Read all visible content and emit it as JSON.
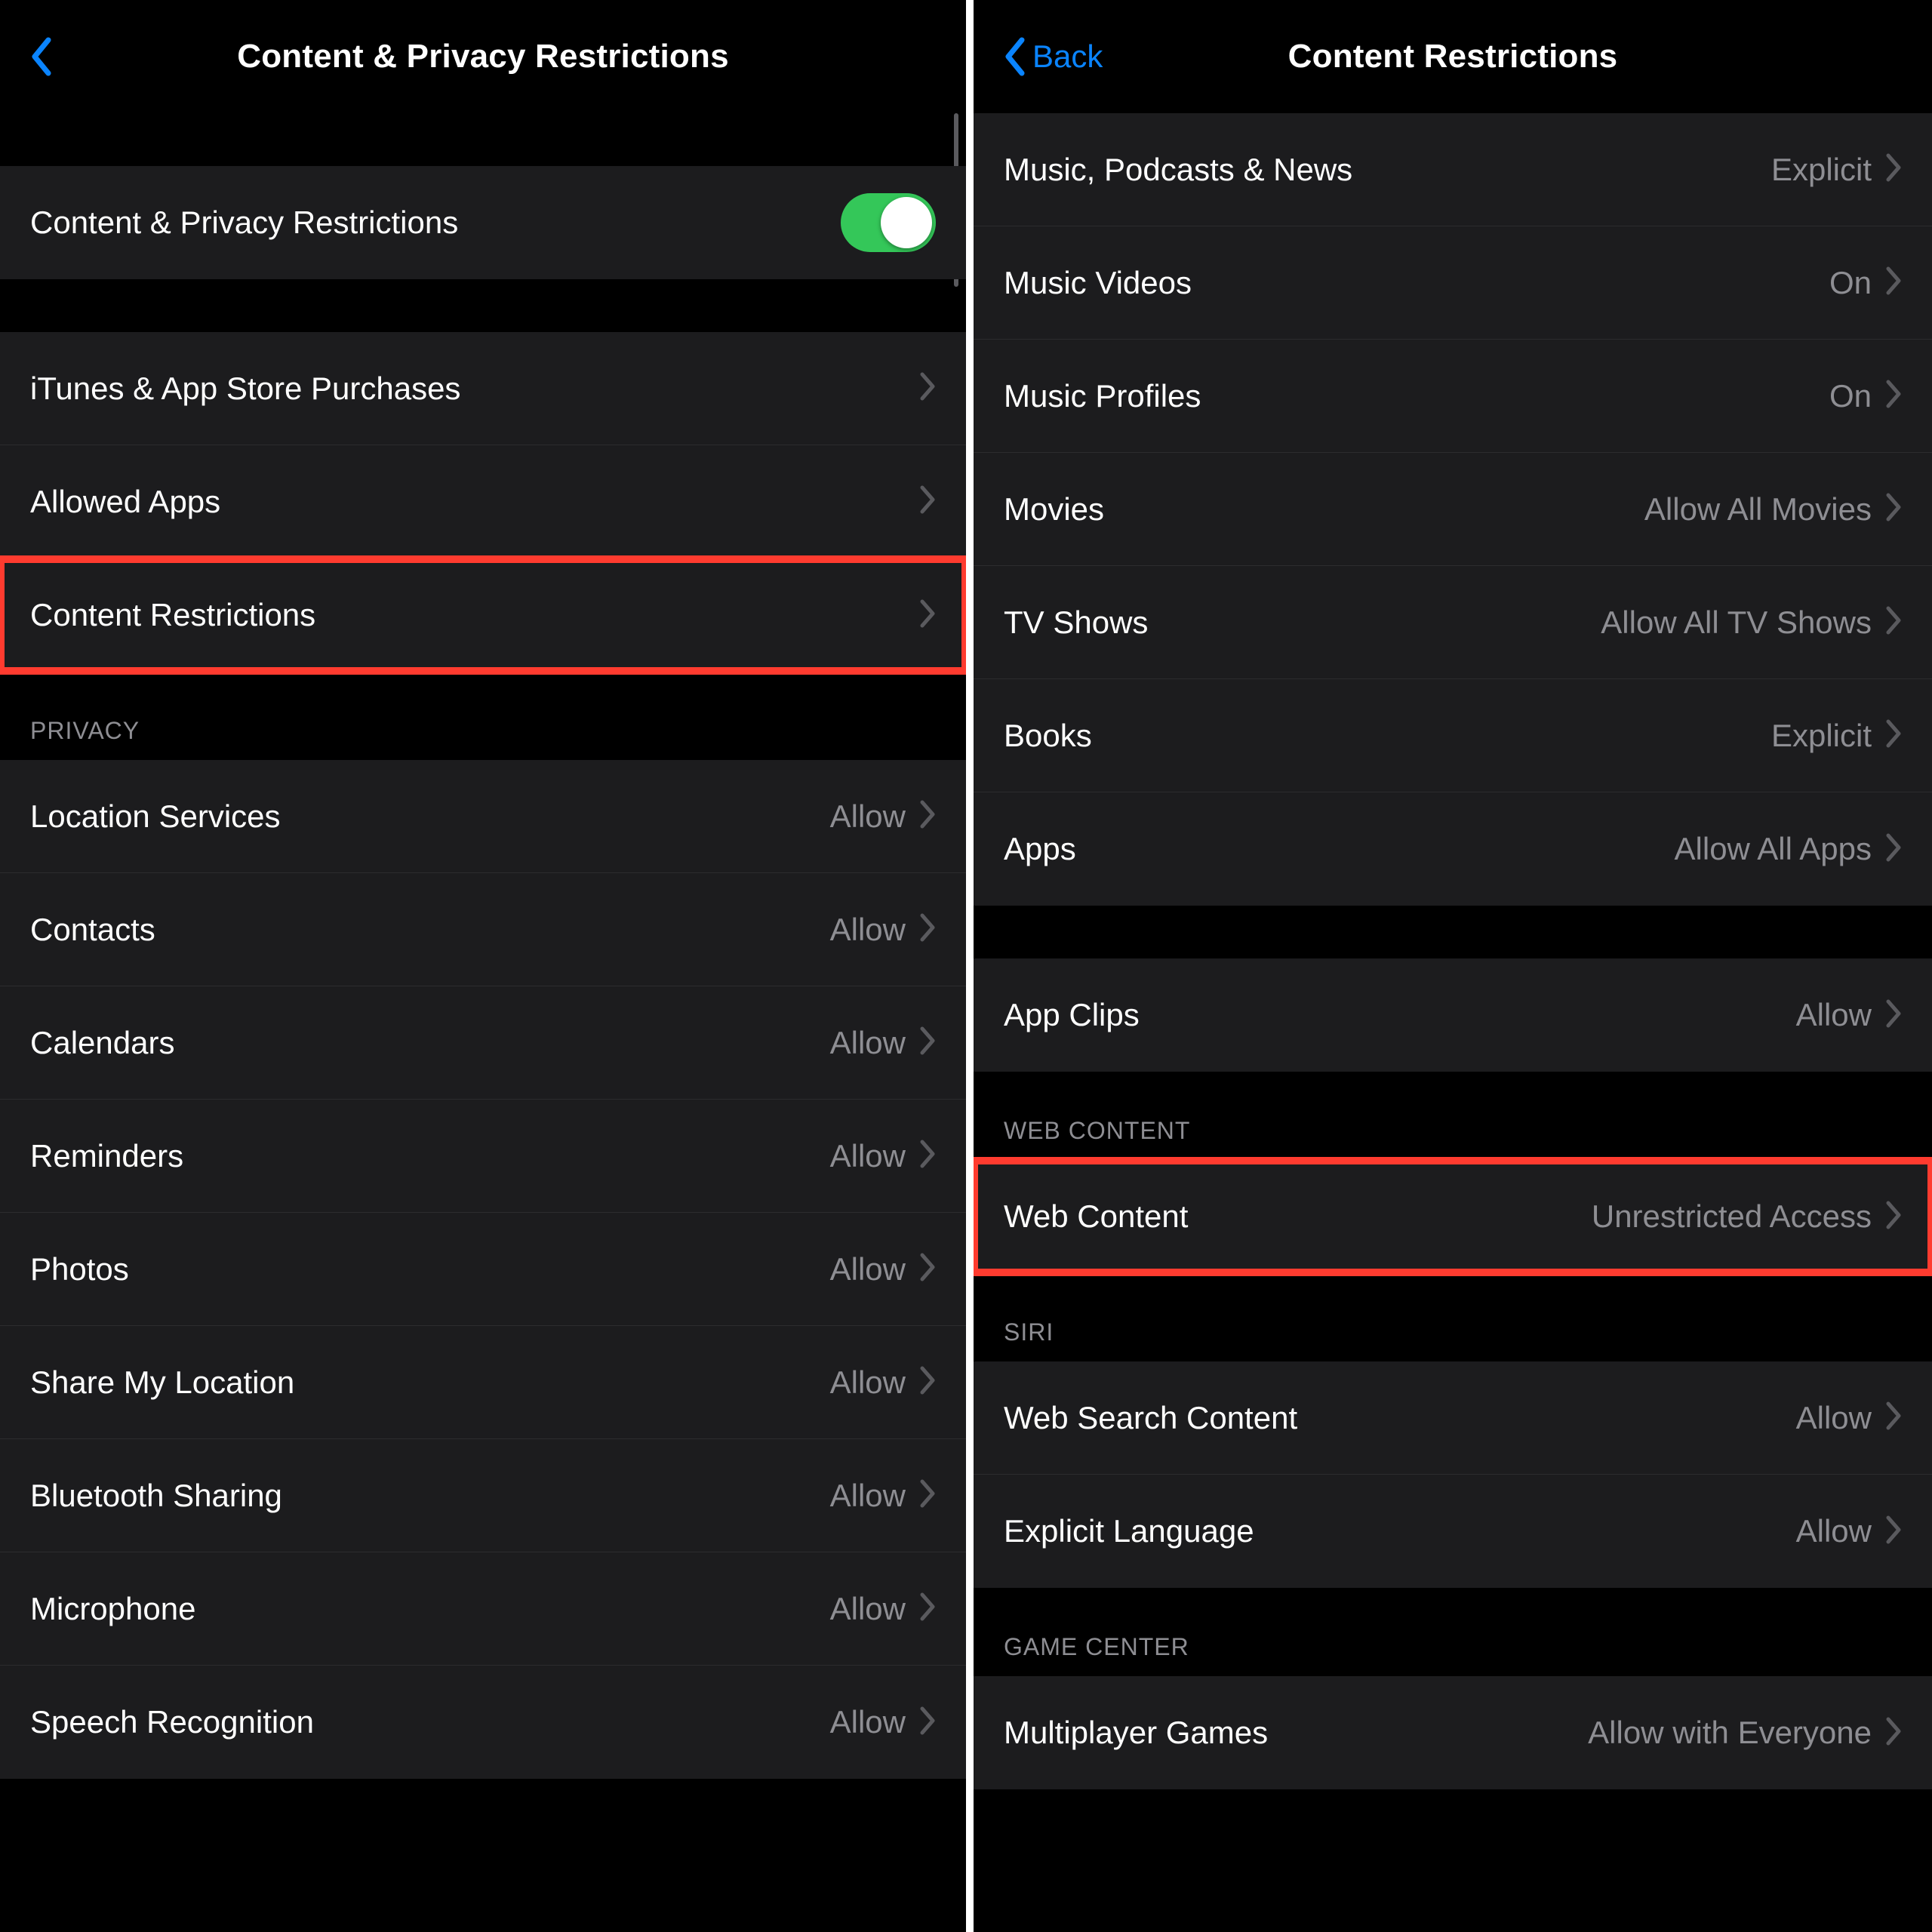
{
  "left": {
    "nav": {
      "title": "Content & Privacy Restrictions",
      "back_label": ""
    },
    "toggle_row": {
      "label": "Content & Privacy Restrictions",
      "on": true
    },
    "group1": [
      {
        "label": "iTunes & App Store Purchases",
        "value": ""
      },
      {
        "label": "Allowed Apps",
        "value": ""
      },
      {
        "label": "Content Restrictions",
        "value": "",
        "highlight": true
      }
    ],
    "privacy_header": "Privacy",
    "privacy": [
      {
        "label": "Location Services",
        "value": "Allow"
      },
      {
        "label": "Contacts",
        "value": "Allow"
      },
      {
        "label": "Calendars",
        "value": "Allow"
      },
      {
        "label": "Reminders",
        "value": "Allow"
      },
      {
        "label": "Photos",
        "value": "Allow"
      },
      {
        "label": "Share My Location",
        "value": "Allow"
      },
      {
        "label": "Bluetooth Sharing",
        "value": "Allow"
      },
      {
        "label": "Microphone",
        "value": "Allow"
      },
      {
        "label": "Speech Recognition",
        "value": "Allow"
      }
    ]
  },
  "right": {
    "nav": {
      "title": "Content Restrictions",
      "back_label": "Back"
    },
    "group1": [
      {
        "label": "Music, Podcasts & News",
        "value": "Explicit"
      },
      {
        "label": "Music Videos",
        "value": "On"
      },
      {
        "label": "Music Profiles",
        "value": "On"
      },
      {
        "label": "Movies",
        "value": "Allow All Movies"
      },
      {
        "label": "TV Shows",
        "value": "Allow All TV Shows"
      },
      {
        "label": "Books",
        "value": "Explicit"
      },
      {
        "label": "Apps",
        "value": "Allow All Apps"
      }
    ],
    "group2": [
      {
        "label": "App Clips",
        "value": "Allow"
      }
    ],
    "web_header": "Web Content",
    "web": [
      {
        "label": "Web Content",
        "value": "Unrestricted Access",
        "highlight": true
      }
    ],
    "siri_header": "Siri",
    "siri": [
      {
        "label": "Web Search Content",
        "value": "Allow"
      },
      {
        "label": "Explicit Language",
        "value": "Allow"
      }
    ],
    "gc_header": "Game Center",
    "gc": [
      {
        "label": "Multiplayer Games",
        "value": "Allow with Everyone"
      }
    ]
  }
}
